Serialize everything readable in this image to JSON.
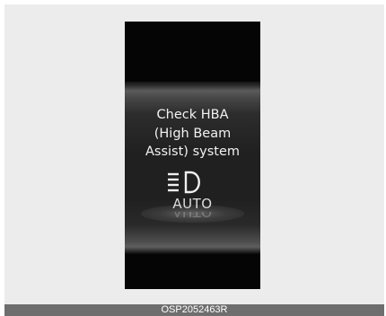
{
  "display": {
    "message_lines": [
      "Check HBA",
      "(High Beam",
      "Assist) system"
    ],
    "icon": "high-beam-headlamp-icon",
    "mode_label": "AUTO",
    "colors": {
      "screen_background": "#050505",
      "text": "#f2f2f2"
    }
  },
  "caption": {
    "code": "OSP2052463R"
  }
}
